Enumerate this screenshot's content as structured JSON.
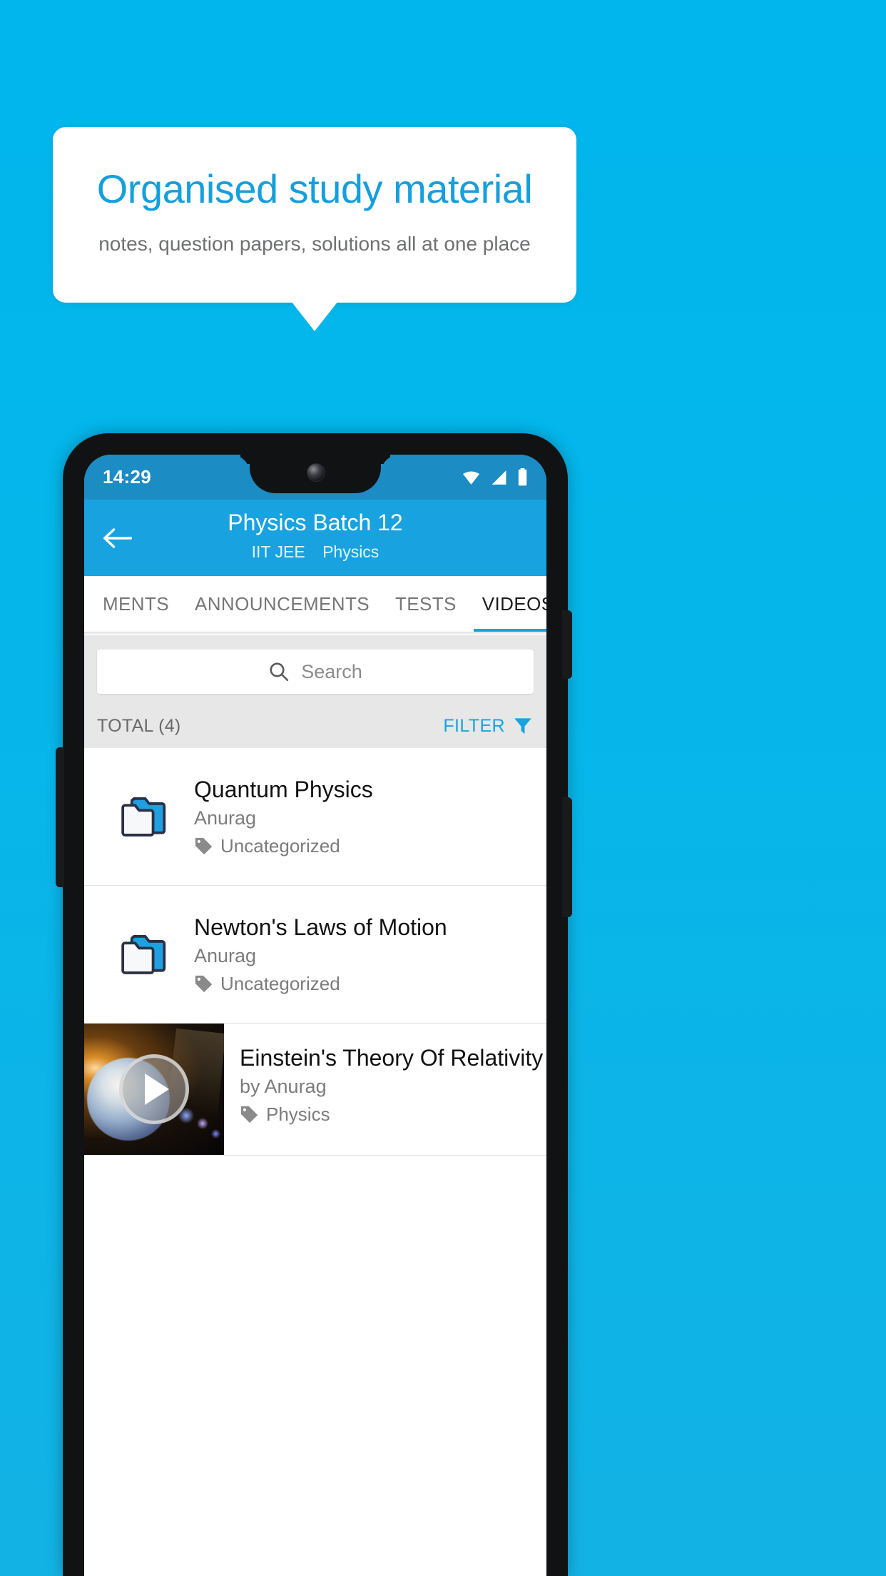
{
  "promo": {
    "title": "Organised study material",
    "subtitle": "notes, question papers, solutions all at one place",
    "title_color": "#159fdc",
    "background_color": "#00b6ec"
  },
  "phone": {
    "status_bar": {
      "time": "14:29",
      "icons": [
        "wifi-icon",
        "signal-icon",
        "battery-icon"
      ],
      "background_color": "#1b8cc4"
    },
    "app_bar": {
      "back_icon": "arrow-left-icon",
      "title": "Physics Batch 12",
      "meta_exam": "IIT JEE",
      "meta_subject": "Physics",
      "background_color": "#18a3e0"
    },
    "tabs": [
      {
        "label": "MENTS",
        "active": false
      },
      {
        "label": "ANNOUNCEMENTS",
        "active": false
      },
      {
        "label": "TESTS",
        "active": false
      },
      {
        "label": "VIDEOS",
        "active": true
      }
    ],
    "search": {
      "icon": "search-icon",
      "placeholder": "Search",
      "value": ""
    },
    "list_header": {
      "total_label": "TOTAL (4)",
      "filter_label": "FILTER",
      "filter_icon": "funnel-icon",
      "filter_color": "#18a3e0"
    },
    "items": [
      {
        "type": "folder",
        "icon": "folder-icon",
        "title": "Quantum Physics",
        "author": "Anurag",
        "tag_icon": "tag-icon",
        "tag": "Uncategorized"
      },
      {
        "type": "folder",
        "icon": "folder-icon",
        "title": "Newton's Laws of Motion",
        "author": "Anurag",
        "tag_icon": "tag-icon",
        "tag": "Uncategorized"
      },
      {
        "type": "video",
        "icon": "play-icon",
        "title": "Einstein's Theory Of Relativity",
        "author": "by Anurag",
        "tag_icon": "tag-icon",
        "tag": "Physics"
      }
    ]
  }
}
